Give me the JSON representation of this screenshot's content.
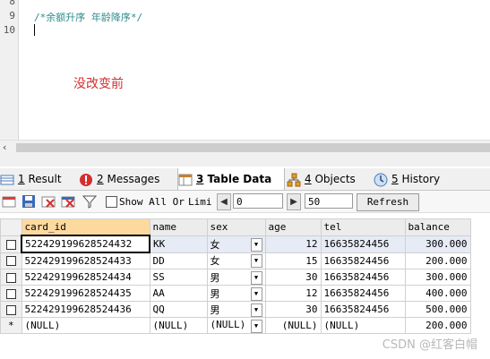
{
  "editor": {
    "line_numbers": [
      "8",
      "9",
      "10"
    ],
    "comment_line": "/*余额升序 年龄降序*/",
    "annotation": "没改变前"
  },
  "tabs": [
    {
      "num": "1",
      "label": "Result",
      "icon": "grid-icon",
      "color": "#4a7ab8"
    },
    {
      "num": "2",
      "label": "Messages",
      "icon": "error-icon",
      "color": "#d32f2f"
    },
    {
      "num": "3",
      "label": "Table Data",
      "icon": "table-data-icon",
      "color": "#c08030"
    },
    {
      "num": "4",
      "label": "Objects",
      "icon": "objects-icon",
      "color": "#e0a020"
    },
    {
      "num": "5",
      "label": "History",
      "icon": "history-icon",
      "color": "#4a7ab8"
    }
  ],
  "toolbar": {
    "show_all_label": "Show All Or",
    "limit_label": "Limi",
    "offset_value": "0",
    "limit_value": "50",
    "refresh_label": "Refresh"
  },
  "table": {
    "columns": [
      "card_id",
      "name",
      "sex",
      "age",
      "tel",
      "balance"
    ],
    "rows": [
      [
        "522429199628524432",
        "KK",
        "女",
        "12",
        "16635824456",
        "300.000"
      ],
      [
        "522429199628524433",
        "DD",
        "女",
        "15",
        "16635824456",
        "200.000"
      ],
      [
        "522429199628524434",
        "SS",
        "男",
        "30",
        "16635824456",
        "300.000"
      ],
      [
        "522429199628524435",
        "AA",
        "男",
        "12",
        "16635824456",
        "400.000"
      ],
      [
        "522429199628524436",
        "QQ",
        "男",
        "30",
        "16635824456",
        "500.000"
      ]
    ],
    "new_row_marker": "*",
    "null_row": [
      "(NULL)",
      "(NULL)",
      "(NULL)",
      "(NULL)",
      "(NULL)",
      "200.000"
    ]
  },
  "watermark": "CSDN @红客白帽"
}
